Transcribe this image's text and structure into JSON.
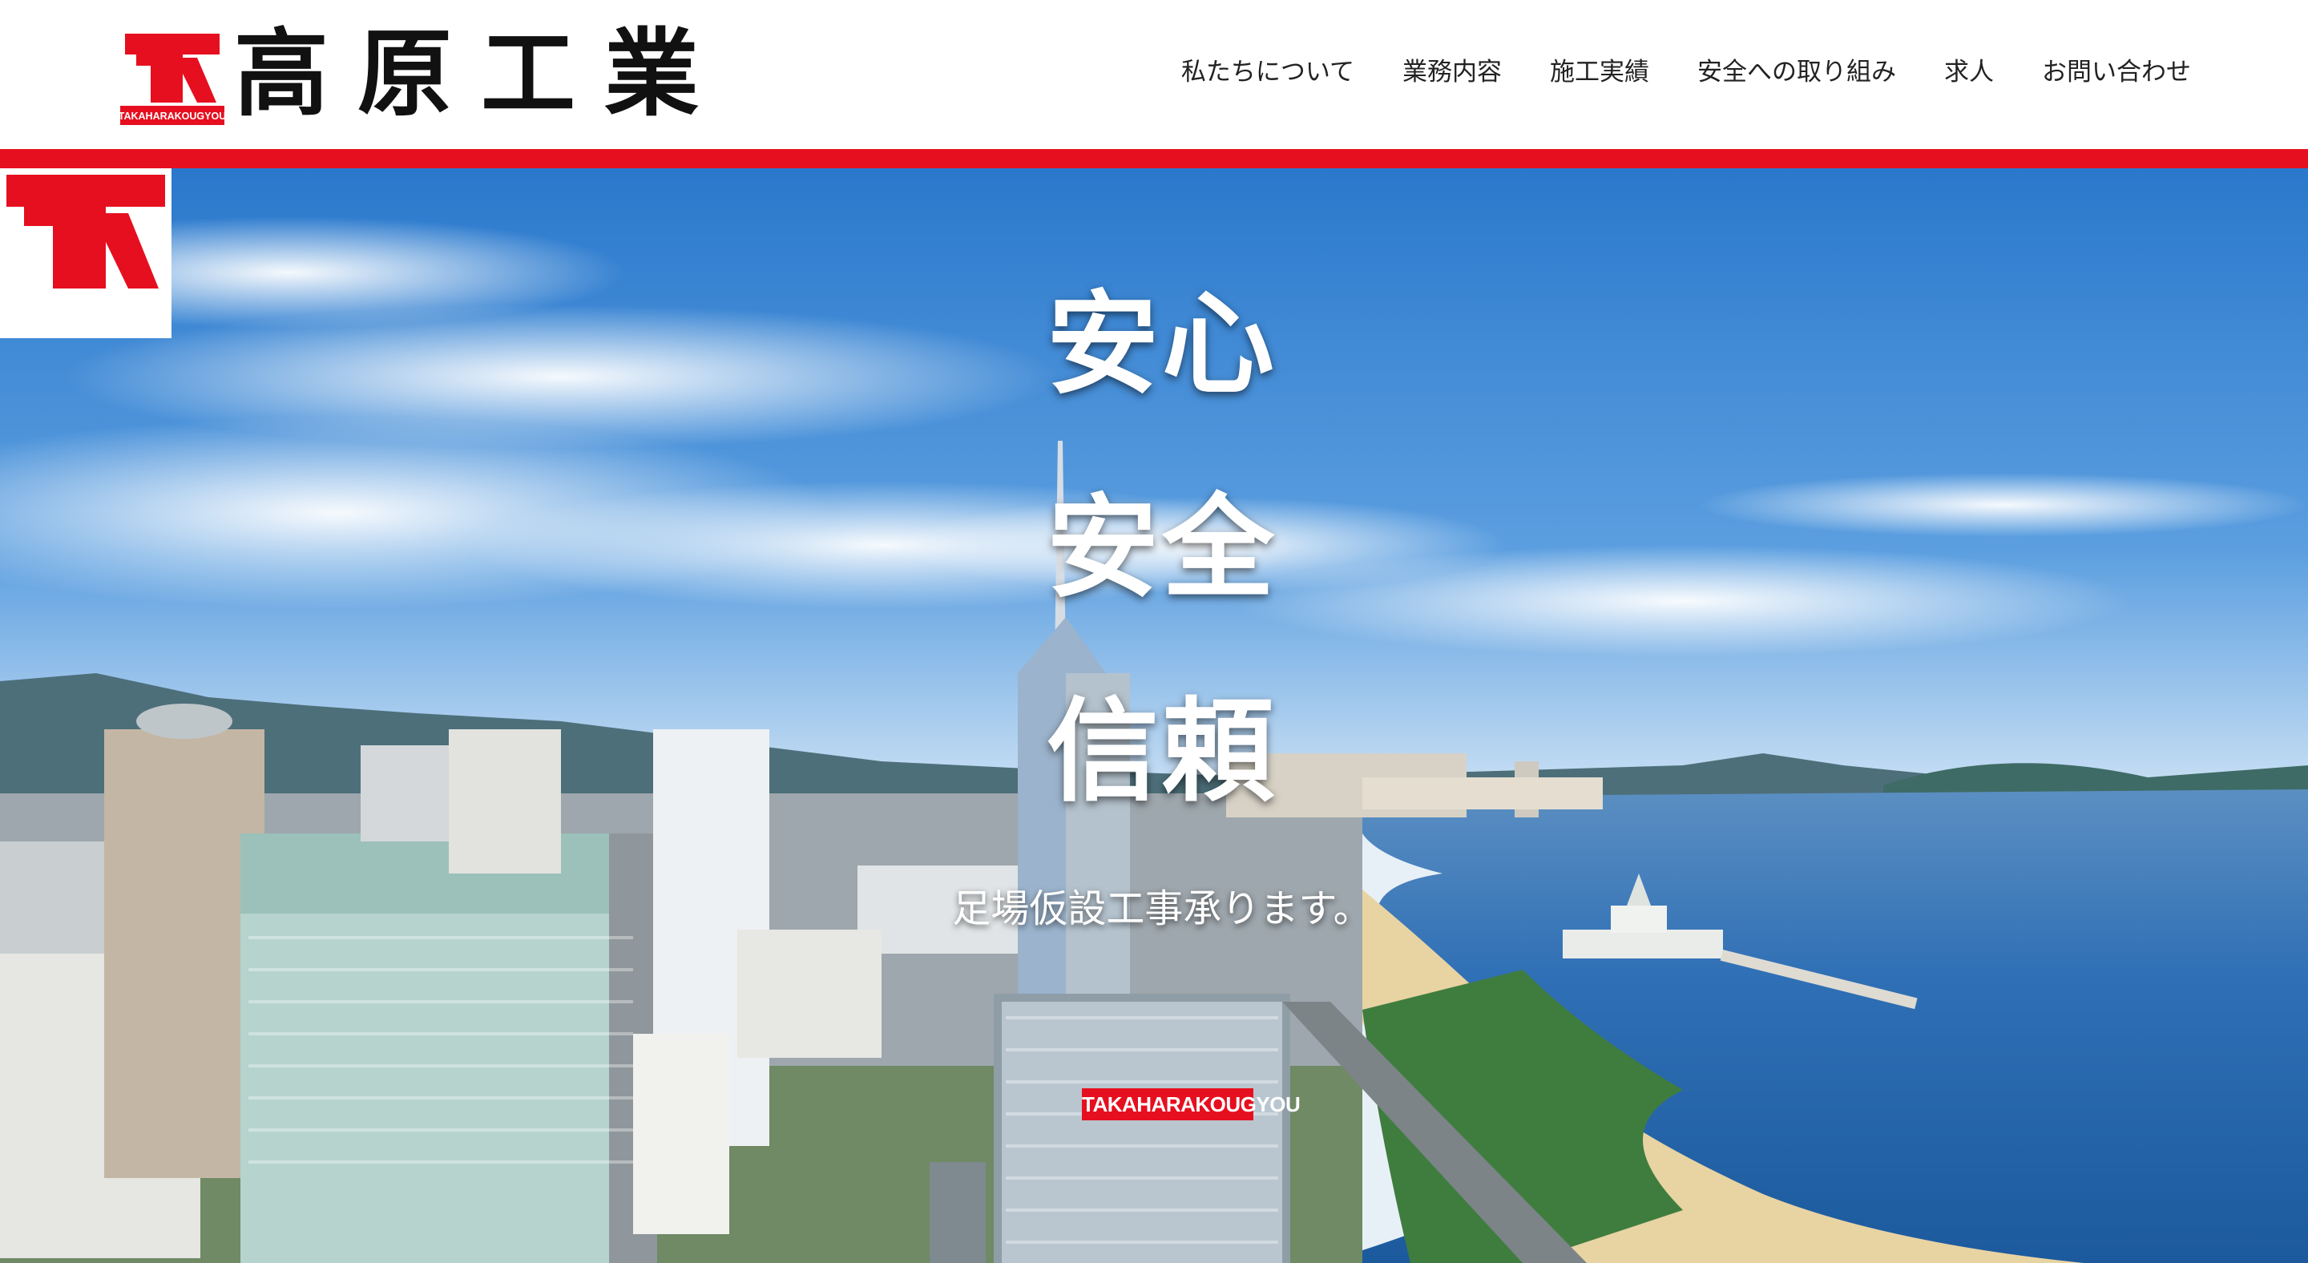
{
  "brand": {
    "name": "高原工業",
    "logo_text": "TAKAHARAKOUGYOU",
    "color_red": "#e60f1f"
  },
  "nav": {
    "items": [
      {
        "label": "私たちについて"
      },
      {
        "label": "業務内容"
      },
      {
        "label": "施工実績"
      },
      {
        "label": "安全への取り組み"
      },
      {
        "label": "求人"
      },
      {
        "label": "お問い合わせ"
      }
    ]
  },
  "hero": {
    "words": [
      "安心",
      "安全",
      "信頼"
    ],
    "tagline": "足場仮設工事承ります。",
    "sign_text": "TAKAHARAKOUGYOU"
  }
}
